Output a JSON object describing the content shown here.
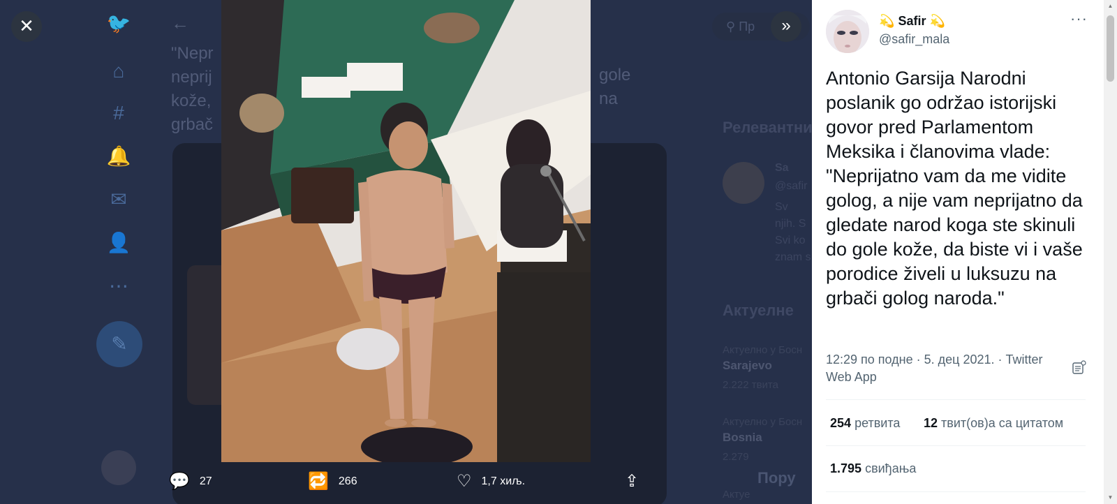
{
  "background": {
    "text_lines": [
      "\"Nepr",
      "neprij",
      "kože,",
      "grbač"
    ],
    "right_text_lines": [
      "gole",
      "na"
    ],
    "search_placeholder": "Пр",
    "relevant_heading": "Релевантни",
    "relevant_user": "Sa",
    "relevant_handle": "@safir",
    "relevant_lines": [
      "Sv",
      "njih. S",
      "Svi ko",
      "znam s"
    ],
    "trends_heading": "Актуелне",
    "trends": [
      {
        "context": "Актуелно у Босн",
        "name": "Sarajevo",
        "count": "2.222 твита"
      },
      {
        "context": "Актуелно у Босн",
        "name": "Bosnia",
        "count": "2.279"
      }
    ],
    "trend_context_partial": "Актуе",
    "messages_partial": "Пору"
  },
  "controls": {
    "close_icon": "✕",
    "expand_icon": "»"
  },
  "actions": {
    "reply_count": "27",
    "retweet_count": "266",
    "like_count": "1,7 хиљ."
  },
  "tweet": {
    "display_name": "Safir",
    "name_emoji": "💫",
    "handle": "@safir_mala",
    "more_icon": "···",
    "text": "Antonio Garsija Narodni poslanik go održao istorijski govor pred Parlamentom Meksika i članovima vlade: \"Neprijatno vam da me vidite golog, a nije vam neprijatno da gledate narod koga ste skinuli do gole kože, da biste vi i vaše porodice živeli u luksuzu na grbači golog naroda.\"",
    "meta": "12:29 по подне · 5. дец 2021. · Twitter Web App",
    "retweets_count": "254",
    "retweets_label": "ретвита",
    "quotes_count": "12",
    "quotes_label": "твит(ов)а са цитатом",
    "likes_count": "1.795",
    "likes_label": "свиђања"
  }
}
